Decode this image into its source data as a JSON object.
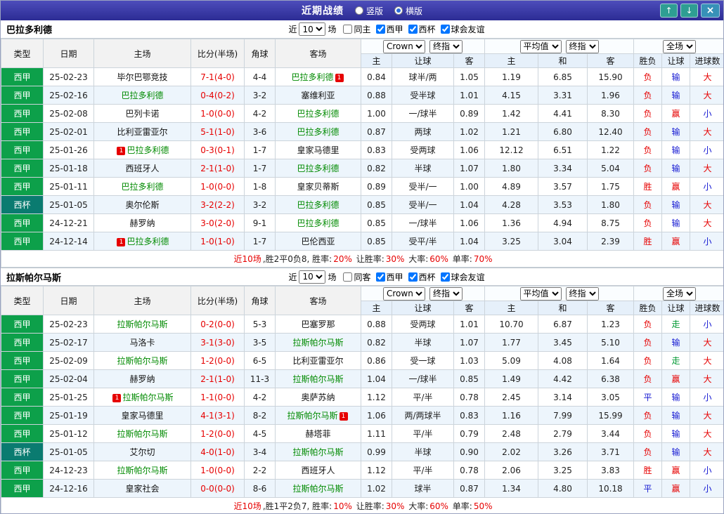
{
  "colors": {
    "red": "#e60000",
    "blue": "#1418d2",
    "green": "#009933",
    "dark": "#222222",
    "self_team": "#008a00",
    "liga_bg": "#0da04a",
    "cup_bg": "#0a7b70",
    "titlebar_start": "#4d4dbb",
    "titlebar_end": "#2c2c94",
    "stripe": "#edf5fc",
    "header_bg": "#f2f2f2",
    "odds_header_bg": "#e6f0fa",
    "radio_dot": "#2b6bd8",
    "nav_btn": "#2e9e93",
    "close_btn": "#3791b8",
    "badge_bg": "#e60000"
  },
  "badge_text": "1",
  "titlebar": {
    "title": "近期战绩",
    "vertical": "竖版",
    "horizontal": "横版",
    "up": "↑",
    "down": "↓",
    "close": "×"
  },
  "controls": {
    "near": "近",
    "count": "10",
    "unit": "场",
    "bookmaker": "Crown",
    "final1": "终指",
    "average": "平均值",
    "final2": "终指",
    "scope": "全场"
  },
  "columns": {
    "type": "类型",
    "date": "日期",
    "home": "主场",
    "score": "比分(半场)",
    "corners": "角球",
    "away": "客场",
    "asian_home": "主",
    "asian_line": "让球",
    "asian_away": "客",
    "euro_home": "主",
    "euro_draw": "和",
    "euro_away": "客",
    "result": "胜负",
    "handicap": "让球",
    "goals": "进球数"
  },
  "sections": [
    {
      "team": "巴拉多利德",
      "filters": [
        {
          "label": "同主",
          "checked": false
        },
        {
          "label": "西甲",
          "checked": true
        },
        {
          "label": "西杯",
          "checked": true
        },
        {
          "label": "球会友谊",
          "checked": true
        }
      ],
      "rows": [
        {
          "league": "西甲",
          "cup": false,
          "date": "25-02-23",
          "home": {
            "name": "毕尔巴鄂竞技",
            "self": false
          },
          "score": "7-1(4-0)",
          "corners": "4-4",
          "away": {
            "name": "巴拉多利德",
            "self": true,
            "badge": "after"
          },
          "asian": {
            "home": "0.84",
            "line": "球半/两",
            "away": "1.05"
          },
          "euro": {
            "home": "1.19",
            "draw": "6.85",
            "away": "15.90"
          },
          "result": [
            "负",
            "red"
          ],
          "handicap": [
            "输",
            "blue"
          ],
          "goals": [
            "大",
            "red"
          ]
        },
        {
          "league": "西甲",
          "cup": false,
          "date": "25-02-16",
          "home": {
            "name": "巴拉多利德",
            "self": true
          },
          "score": "0-4(0-2)",
          "corners": "3-2",
          "away": {
            "name": "塞维利亚",
            "self": false
          },
          "asian": {
            "home": "0.88",
            "line": "受半球",
            "away": "1.01"
          },
          "euro": {
            "home": "4.15",
            "draw": "3.31",
            "away": "1.96"
          },
          "result": [
            "负",
            "red"
          ],
          "handicap": [
            "输",
            "blue"
          ],
          "goals": [
            "大",
            "red"
          ]
        },
        {
          "league": "西甲",
          "cup": false,
          "date": "25-02-08",
          "home": {
            "name": "巴列卡诺",
            "self": false
          },
          "score": "1-0(0-0)",
          "corners": "4-2",
          "away": {
            "name": "巴拉多利德",
            "self": true
          },
          "asian": {
            "home": "1.00",
            "line": "一/球半",
            "away": "0.89"
          },
          "euro": {
            "home": "1.42",
            "draw": "4.41",
            "away": "8.30"
          },
          "result": [
            "负",
            "red"
          ],
          "handicap": [
            "赢",
            "red"
          ],
          "goals": [
            "小",
            "blue"
          ]
        },
        {
          "league": "西甲",
          "cup": false,
          "date": "25-02-01",
          "home": {
            "name": "比利亚雷亚尔",
            "self": false
          },
          "score": "5-1(1-0)",
          "corners": "3-6",
          "away": {
            "name": "巴拉多利德",
            "self": true
          },
          "asian": {
            "home": "0.87",
            "line": "两球",
            "away": "1.02"
          },
          "euro": {
            "home": "1.21",
            "draw": "6.80",
            "away": "12.40"
          },
          "result": [
            "负",
            "red"
          ],
          "handicap": [
            "输",
            "blue"
          ],
          "goals": [
            "大",
            "red"
          ]
        },
        {
          "league": "西甲",
          "cup": false,
          "date": "25-01-26",
          "home": {
            "name": "巴拉多利德",
            "self": true,
            "badge": "before"
          },
          "score": "0-3(0-1)",
          "corners": "1-7",
          "away": {
            "name": "皇家马德里",
            "self": false
          },
          "asian": {
            "home": "0.83",
            "line": "受两球",
            "away": "1.06"
          },
          "euro": {
            "home": "12.12",
            "draw": "6.51",
            "away": "1.22"
          },
          "result": [
            "负",
            "red"
          ],
          "handicap": [
            "输",
            "blue"
          ],
          "goals": [
            "小",
            "blue"
          ]
        },
        {
          "league": "西甲",
          "cup": false,
          "date": "25-01-18",
          "home": {
            "name": "西班牙人",
            "self": false
          },
          "score": "2-1(1-0)",
          "corners": "1-7",
          "away": {
            "name": "巴拉多利德",
            "self": true
          },
          "asian": {
            "home": "0.82",
            "line": "半球",
            "away": "1.07"
          },
          "euro": {
            "home": "1.80",
            "draw": "3.34",
            "away": "5.04"
          },
          "result": [
            "负",
            "red"
          ],
          "handicap": [
            "输",
            "blue"
          ],
          "goals": [
            "大",
            "red"
          ]
        },
        {
          "league": "西甲",
          "cup": false,
          "date": "25-01-11",
          "home": {
            "name": "巴拉多利德",
            "self": true
          },
          "score": "1-0(0-0)",
          "corners": "1-8",
          "away": {
            "name": "皇家贝蒂斯",
            "self": false
          },
          "asian": {
            "home": "0.89",
            "line": "受半/一",
            "away": "1.00"
          },
          "euro": {
            "home": "4.89",
            "draw": "3.57",
            "away": "1.75"
          },
          "result": [
            "胜",
            "red"
          ],
          "handicap": [
            "赢",
            "red"
          ],
          "goals": [
            "小",
            "blue"
          ]
        },
        {
          "league": "西杯",
          "cup": true,
          "date": "25-01-05",
          "home": {
            "name": "奥尔伦斯",
            "self": false
          },
          "score": "3-2(2-2)",
          "corners": "3-2",
          "away": {
            "name": "巴拉多利德",
            "self": true
          },
          "asian": {
            "home": "0.85",
            "line": "受半/一",
            "away": "1.04"
          },
          "euro": {
            "home": "4.28",
            "draw": "3.53",
            "away": "1.80"
          },
          "result": [
            "负",
            "red"
          ],
          "handicap": [
            "输",
            "blue"
          ],
          "goals": [
            "大",
            "red"
          ]
        },
        {
          "league": "西甲",
          "cup": false,
          "date": "24-12-21",
          "home": {
            "name": "赫罗纳",
            "self": false
          },
          "score": "3-0(2-0)",
          "corners": "9-1",
          "away": {
            "name": "巴拉多利德",
            "self": true
          },
          "asian": {
            "home": "0.85",
            "line": "一/球半",
            "away": "1.06"
          },
          "euro": {
            "home": "1.36",
            "draw": "4.94",
            "away": "8.75"
          },
          "result": [
            "负",
            "red"
          ],
          "handicap": [
            "输",
            "blue"
          ],
          "goals": [
            "大",
            "red"
          ]
        },
        {
          "league": "西甲",
          "cup": false,
          "date": "24-12-14",
          "home": {
            "name": "巴拉多利德",
            "self": true,
            "badge": "before"
          },
          "score": "1-0(1-0)",
          "corners": "1-7",
          "away": {
            "name": "巴伦西亚",
            "self": false
          },
          "asian": {
            "home": "0.85",
            "line": "受平/半",
            "away": "1.04"
          },
          "euro": {
            "home": "3.25",
            "draw": "3.04",
            "away": "2.39"
          },
          "result": [
            "胜",
            "red"
          ],
          "handicap": [
            "赢",
            "red"
          ],
          "goals": [
            "小",
            "blue"
          ]
        }
      ],
      "summary": [
        [
          "近10场",
          "red"
        ],
        [
          ",胜2平0负8, 胜率:",
          "dark"
        ],
        [
          "20%",
          "red"
        ],
        [
          " 让胜率:",
          "dark"
        ],
        [
          "30%",
          "red"
        ],
        [
          " 大率:",
          "dark"
        ],
        [
          "60%",
          "red"
        ],
        [
          " 单率:",
          "dark"
        ],
        [
          "70%",
          "red"
        ]
      ]
    },
    {
      "team": "拉斯帕尔马斯",
      "filters": [
        {
          "label": "同客",
          "checked": false
        },
        {
          "label": "西甲",
          "checked": true
        },
        {
          "label": "西杯",
          "checked": true
        },
        {
          "label": "球会友谊",
          "checked": true
        }
      ],
      "rows": [
        {
          "league": "西甲",
          "cup": false,
          "date": "25-02-23",
          "home": {
            "name": "拉斯帕尔马斯",
            "self": true
          },
          "score": "0-2(0-0)",
          "corners": "5-3",
          "away": {
            "name": "巴塞罗那",
            "self": false
          },
          "asian": {
            "home": "0.88",
            "line": "受两球",
            "away": "1.01"
          },
          "euro": {
            "home": "10.70",
            "draw": "6.87",
            "away": "1.23"
          },
          "result": [
            "负",
            "red"
          ],
          "handicap": [
            "走",
            "green"
          ],
          "goals": [
            "小",
            "blue"
          ]
        },
        {
          "league": "西甲",
          "cup": false,
          "date": "25-02-17",
          "home": {
            "name": "马洛卡",
            "self": false
          },
          "score": "3-1(3-0)",
          "corners": "3-5",
          "away": {
            "name": "拉斯帕尔马斯",
            "self": true
          },
          "asian": {
            "home": "0.82",
            "line": "半球",
            "away": "1.07"
          },
          "euro": {
            "home": "1.77",
            "draw": "3.45",
            "away": "5.10"
          },
          "result": [
            "负",
            "red"
          ],
          "handicap": [
            "输",
            "blue"
          ],
          "goals": [
            "大",
            "red"
          ]
        },
        {
          "league": "西甲",
          "cup": false,
          "date": "25-02-09",
          "home": {
            "name": "拉斯帕尔马斯",
            "self": true
          },
          "score": "1-2(0-0)",
          "corners": "6-5",
          "away": {
            "name": "比利亚雷亚尔",
            "self": false
          },
          "asian": {
            "home": "0.86",
            "line": "受一球",
            "away": "1.03"
          },
          "euro": {
            "home": "5.09",
            "draw": "4.08",
            "away": "1.64"
          },
          "result": [
            "负",
            "red"
          ],
          "handicap": [
            "走",
            "green"
          ],
          "goals": [
            "大",
            "red"
          ]
        },
        {
          "league": "西甲",
          "cup": false,
          "date": "25-02-04",
          "home": {
            "name": "赫罗纳",
            "self": false
          },
          "score": "2-1(1-0)",
          "corners": "11-3",
          "away": {
            "name": "拉斯帕尔马斯",
            "self": true
          },
          "asian": {
            "home": "1.04",
            "line": "一/球半",
            "away": "0.85"
          },
          "euro": {
            "home": "1.49",
            "draw": "4.42",
            "away": "6.38"
          },
          "result": [
            "负",
            "red"
          ],
          "handicap": [
            "赢",
            "red"
          ],
          "goals": [
            "大",
            "red"
          ]
        },
        {
          "league": "西甲",
          "cup": false,
          "date": "25-01-25",
          "home": {
            "name": "拉斯帕尔马斯",
            "self": true,
            "badge": "before"
          },
          "score": "1-1(0-0)",
          "corners": "4-2",
          "away": {
            "name": "奥萨苏纳",
            "self": false
          },
          "asian": {
            "home": "1.12",
            "line": "平/半",
            "away": "0.78"
          },
          "euro": {
            "home": "2.45",
            "draw": "3.14",
            "away": "3.05"
          },
          "result": [
            "平",
            "blue"
          ],
          "handicap": [
            "输",
            "blue"
          ],
          "goals": [
            "小",
            "blue"
          ]
        },
        {
          "league": "西甲",
          "cup": false,
          "date": "25-01-19",
          "home": {
            "name": "皇家马德里",
            "self": false
          },
          "score": "4-1(3-1)",
          "corners": "8-2",
          "away": {
            "name": "拉斯帕尔马斯",
            "self": true,
            "badge": "after"
          },
          "asian": {
            "home": "1.06",
            "line": "两/两球半",
            "away": "0.83"
          },
          "euro": {
            "home": "1.16",
            "draw": "7.99",
            "away": "15.99"
          },
          "result": [
            "负",
            "red"
          ],
          "handicap": [
            "输",
            "blue"
          ],
          "goals": [
            "大",
            "red"
          ]
        },
        {
          "league": "西甲",
          "cup": false,
          "date": "25-01-12",
          "home": {
            "name": "拉斯帕尔马斯",
            "self": true
          },
          "score": "1-2(0-0)",
          "corners": "4-5",
          "away": {
            "name": "赫塔菲",
            "self": false
          },
          "asian": {
            "home": "1.11",
            "line": "平/半",
            "away": "0.79"
          },
          "euro": {
            "home": "2.48",
            "draw": "2.79",
            "away": "3.44"
          },
          "result": [
            "负",
            "red"
          ],
          "handicap": [
            "输",
            "blue"
          ],
          "goals": [
            "大",
            "red"
          ]
        },
        {
          "league": "西杯",
          "cup": true,
          "date": "25-01-05",
          "home": {
            "name": "艾尔切",
            "self": false
          },
          "score": "4-0(1-0)",
          "corners": "3-4",
          "away": {
            "name": "拉斯帕尔马斯",
            "self": true
          },
          "asian": {
            "home": "0.99",
            "line": "半球",
            "away": "0.90"
          },
          "euro": {
            "home": "2.02",
            "draw": "3.26",
            "away": "3.71"
          },
          "result": [
            "负",
            "red"
          ],
          "handicap": [
            "输",
            "blue"
          ],
          "goals": [
            "大",
            "red"
          ]
        },
        {
          "league": "西甲",
          "cup": false,
          "date": "24-12-23",
          "home": {
            "name": "拉斯帕尔马斯",
            "self": true
          },
          "score": "1-0(0-0)",
          "corners": "2-2",
          "away": {
            "name": "西班牙人",
            "self": false
          },
          "asian": {
            "home": "1.12",
            "line": "平/半",
            "away": "0.78"
          },
          "euro": {
            "home": "2.06",
            "draw": "3.25",
            "away": "3.83"
          },
          "result": [
            "胜",
            "red"
          ],
          "handicap": [
            "赢",
            "red"
          ],
          "goals": [
            "小",
            "blue"
          ]
        },
        {
          "league": "西甲",
          "cup": false,
          "date": "24-12-16",
          "home": {
            "name": "皇家社会",
            "self": false
          },
          "score": "0-0(0-0)",
          "corners": "8-6",
          "away": {
            "name": "拉斯帕尔马斯",
            "self": true
          },
          "asian": {
            "home": "1.02",
            "line": "球半",
            "away": "0.87"
          },
          "euro": {
            "home": "1.34",
            "draw": "4.80",
            "away": "10.18"
          },
          "result": [
            "平",
            "blue"
          ],
          "handicap": [
            "赢",
            "red"
          ],
          "goals": [
            "小",
            "blue"
          ]
        }
      ],
      "summary": [
        [
          "近10场",
          "red"
        ],
        [
          ",胜1平2负7, 胜率:",
          "dark"
        ],
        [
          "10%",
          "red"
        ],
        [
          " 让胜率:",
          "dark"
        ],
        [
          "30%",
          "red"
        ],
        [
          " 大率:",
          "dark"
        ],
        [
          "60%",
          "red"
        ],
        [
          " 单率:",
          "dark"
        ],
        [
          "50%",
          "red"
        ]
      ]
    }
  ]
}
